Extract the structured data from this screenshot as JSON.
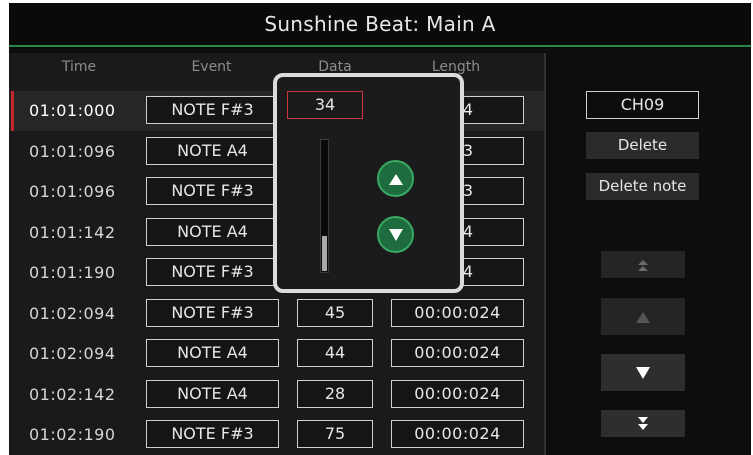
{
  "title": "Sunshine Beat: Main A",
  "columns": {
    "time": "Time",
    "event": "Event",
    "data": "Data",
    "length": "Length"
  },
  "rows": [
    {
      "time": "01:01:000",
      "event": "NOTE F#3",
      "data": "",
      "length": "024",
      "selected": true
    },
    {
      "time": "01:01:096",
      "event": "NOTE A4",
      "data": "",
      "length": "023"
    },
    {
      "time": "01:01:096",
      "event": "NOTE F#3",
      "data": "",
      "length": "023"
    },
    {
      "time": "01:01:142",
      "event": "NOTE A4",
      "data": "",
      "length": "024"
    },
    {
      "time": "01:01:190",
      "event": "NOTE F#3",
      "data": "",
      "length": "024"
    },
    {
      "time": "01:02:094",
      "event": "NOTE F#3",
      "data": "45",
      "length": "00:00:024"
    },
    {
      "time": "01:02:094",
      "event": "NOTE A4",
      "data": "44",
      "length": "00:00:024"
    },
    {
      "time": "01:02:142",
      "event": "NOTE A4",
      "data": "28",
      "length": "00:00:024"
    },
    {
      "time": "01:02:190",
      "event": "NOTE F#3",
      "data": "75",
      "length": "00:00:024"
    }
  ],
  "side": {
    "channel": "CH09",
    "delete_label": "Delete",
    "delete_note_label": "Delete note",
    "nav_icons": [
      "double-up-icon",
      "up-icon",
      "down-icon",
      "double-down-icon"
    ]
  },
  "popup": {
    "value": "34",
    "slider_level": 0.27,
    "up_icon": "up-arrow-icon",
    "down_icon": "down-arrow-icon"
  },
  "colors": {
    "accent_green": "#2a8a4a",
    "selected_marker": "#c0262c",
    "popup_button": "#1e6b3f"
  }
}
